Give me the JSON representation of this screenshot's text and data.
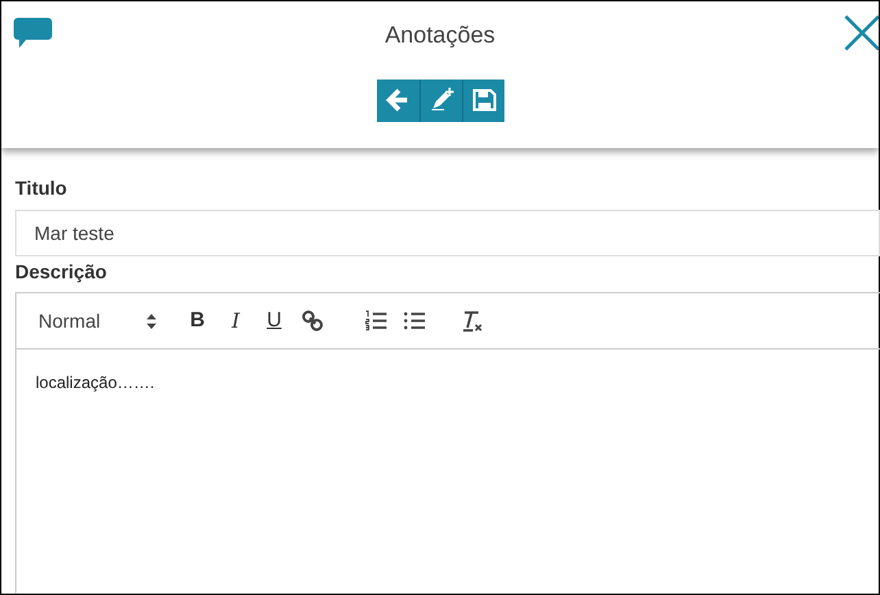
{
  "window": {
    "title": "Anotações"
  },
  "toolbar": {
    "buttons": [
      {
        "kind": "back"
      },
      {
        "kind": "new"
      },
      {
        "kind": "save"
      }
    ]
  },
  "fields": {
    "title_label": "Titulo",
    "title_value": "Mar teste",
    "description_label": "Descrição"
  },
  "editor": {
    "format": "Normal",
    "buttons": [
      {
        "kind": "bold",
        "label": "B"
      },
      {
        "kind": "italic",
        "label": "I"
      },
      {
        "kind": "underline",
        "label": "U"
      },
      {
        "kind": "link"
      },
      {
        "kind": "ordered"
      },
      {
        "kind": "bullet"
      },
      {
        "kind": "clean"
      }
    ],
    "content": "localização……."
  }
}
